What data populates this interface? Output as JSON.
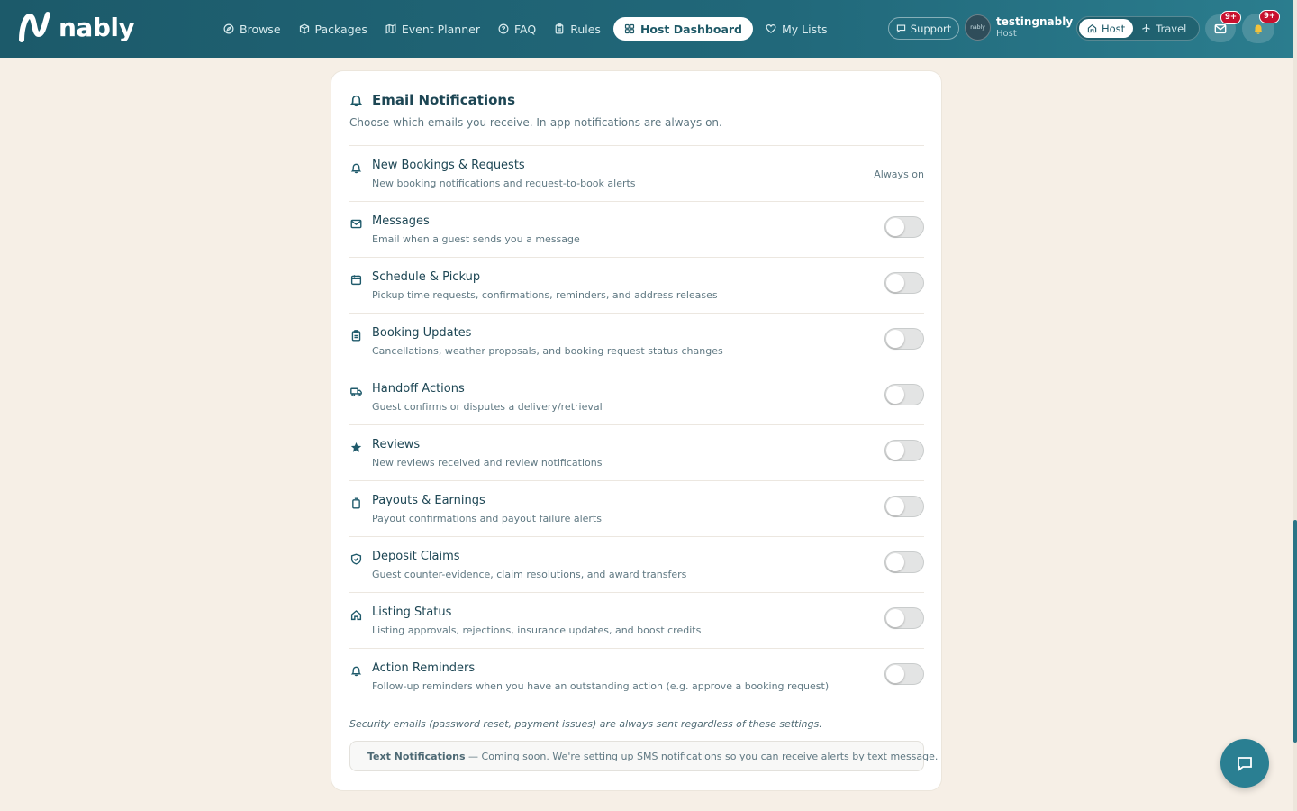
{
  "brand": {
    "name": "nably"
  },
  "nav": {
    "links": [
      {
        "label": "Browse",
        "icon": "compass-icon"
      },
      {
        "label": "Packages",
        "icon": "package-icon"
      },
      {
        "label": "Event Planner",
        "icon": "map-icon"
      },
      {
        "label": "FAQ",
        "icon": "help-circle-icon"
      },
      {
        "label": "Rules",
        "icon": "clipboard-icon"
      },
      {
        "label": "Host Dashboard",
        "icon": "grid-icon",
        "active": true
      },
      {
        "label": "My Lists",
        "icon": "heart-icon"
      }
    ],
    "support_label": "Support",
    "user": {
      "name": "testingnably",
      "role": "Host",
      "avatar_text": "nably"
    },
    "modes": {
      "host": "Host",
      "travel": "Travel"
    },
    "messages_badge": "9+",
    "notifications_badge": "9+"
  },
  "card": {
    "title": "Email Notifications",
    "subtitle": "Choose which emails you receive. In-app notifications are always on.",
    "always_on_label": "Always on",
    "rows": [
      {
        "title": "New Bookings & Requests",
        "desc": "New booking notifications and request-to-book alerts",
        "icon": "bell-icon",
        "always_on": true
      },
      {
        "title": "Messages",
        "desc": "Email when a guest sends you a message",
        "icon": "mail-icon",
        "enabled": false
      },
      {
        "title": "Schedule & Pickup",
        "desc": "Pickup time requests, confirmations, reminders, and address releases",
        "icon": "calendar-icon",
        "enabled": false
      },
      {
        "title": "Booking Updates",
        "desc": "Cancellations, weather proposals, and booking request status changes",
        "icon": "clipboard-icon",
        "enabled": false
      },
      {
        "title": "Handoff Actions",
        "desc": "Guest confirms or disputes a delivery/retrieval",
        "icon": "truck-icon",
        "enabled": false
      },
      {
        "title": "Reviews",
        "desc": "New reviews received and review notifications",
        "icon": "star-icon",
        "enabled": false
      },
      {
        "title": "Payouts & Earnings",
        "desc": "Payout confirmations and payout failure alerts",
        "icon": "wallet-icon",
        "enabled": false
      },
      {
        "title": "Deposit Claims",
        "desc": "Guest counter-evidence, claim resolutions, and award transfers",
        "icon": "shield-check-icon",
        "enabled": false
      },
      {
        "title": "Listing Status",
        "desc": "Listing approvals, rejections, insurance updates, and boost credits",
        "icon": "home-icon",
        "enabled": false
      },
      {
        "title": "Action Reminders",
        "desc": "Follow-up reminders when you have an outstanding action (e.g. approve a booking request)",
        "icon": "bell-icon",
        "enabled": false
      }
    ],
    "security_note": "Security emails (password reset, payment issues) are always sent regardless of these settings.",
    "text_notifications": {
      "label": "Text Notifications",
      "message": " — Coming soon. We're setting up SMS notifications so you can receive alerts by text message."
    }
  },
  "colors": {
    "accent": "#21687a",
    "badge": "#c8102e",
    "page_bg": "#f6efe6"
  }
}
